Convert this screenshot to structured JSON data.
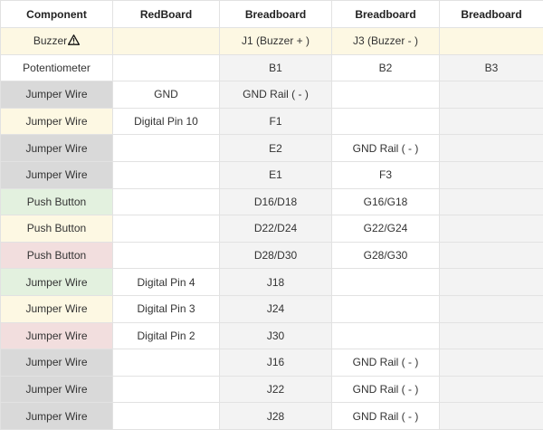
{
  "headers": [
    "Component",
    "RedBoard",
    "Breadboard",
    "Breadboard",
    "Breadboard"
  ],
  "rows": [
    {
      "component": "Buzzer",
      "tint": "yellow",
      "warning": true,
      "cells": [
        "",
        "J1 (Buzzer + )",
        "J3 (Buzzer - )",
        ""
      ]
    },
    {
      "component": "Potentiometer",
      "tint": "white",
      "cells": [
        "",
        "B1",
        "B2",
        "B3"
      ]
    },
    {
      "component": "Jumper Wire",
      "tint": "grey",
      "cells": [
        "GND",
        "GND Rail ( - )",
        "",
        ""
      ]
    },
    {
      "component": "Jumper Wire",
      "tint": "yellow",
      "cells": [
        "Digital Pin 10",
        "F1",
        "",
        ""
      ]
    },
    {
      "component": "Jumper Wire",
      "tint": "grey",
      "cells": [
        "",
        "E2",
        "GND Rail ( - )",
        ""
      ]
    },
    {
      "component": "Jumper Wire",
      "tint": "grey",
      "cells": [
        "",
        "E1",
        "F3",
        ""
      ]
    },
    {
      "component": "Push Button",
      "tint": "green",
      "cells": [
        "",
        "D16/D18",
        "G16/G18",
        ""
      ]
    },
    {
      "component": "Push Button",
      "tint": "yellow",
      "cells": [
        "",
        "D22/D24",
        "G22/G24",
        ""
      ]
    },
    {
      "component": "Push Button",
      "tint": "pink",
      "cells": [
        "",
        "D28/D30",
        "G28/G30",
        ""
      ]
    },
    {
      "component": "Jumper Wire",
      "tint": "green",
      "cells": [
        "Digital Pin 4",
        "J18",
        "",
        ""
      ]
    },
    {
      "component": "Jumper Wire",
      "tint": "yellow",
      "cells": [
        "Digital Pin 3",
        "J24",
        "",
        ""
      ]
    },
    {
      "component": "Jumper Wire",
      "tint": "pink",
      "cells": [
        "Digital Pin 2",
        "J30",
        "",
        ""
      ]
    },
    {
      "component": "Jumper Wire",
      "tint": "grey",
      "cells": [
        "",
        "J16",
        "GND Rail ( - )",
        ""
      ]
    },
    {
      "component": "Jumper Wire",
      "tint": "grey",
      "cells": [
        "",
        "J22",
        "GND Rail ( - )",
        ""
      ]
    },
    {
      "component": "Jumper Wire",
      "tint": "grey",
      "cells": [
        "",
        "J28",
        "GND Rail ( - )",
        ""
      ]
    }
  ],
  "colors": {
    "grey": "#d9d9d9",
    "yellow": "#fdf8e3",
    "green": "#e3f1df",
    "pink": "#f2dede",
    "white": "#ffffff",
    "alt_cell": "#f3f3f3",
    "border": "#e2e2e2"
  },
  "icons": {
    "warning": "warning-triangle-icon"
  }
}
